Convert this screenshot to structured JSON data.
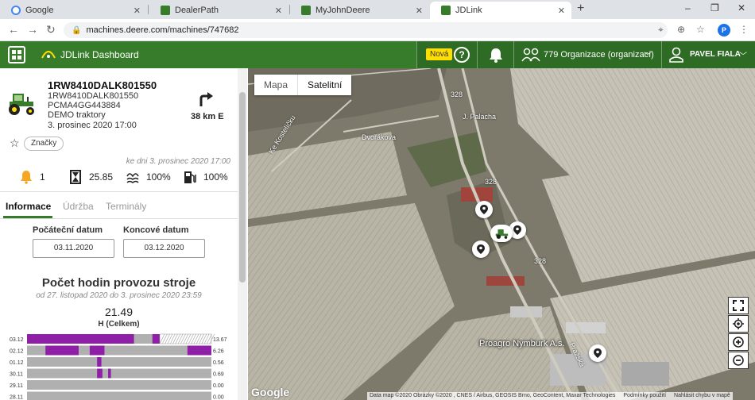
{
  "browser": {
    "tabs": [
      {
        "title": "Google",
        "favicon_color": "#4285f4"
      },
      {
        "title": "DealerPath",
        "favicon_color": "#367c2b"
      },
      {
        "title": "MyJohnDeere",
        "favicon_color": "#367c2b"
      },
      {
        "title": "JDLink",
        "favicon_color": "#367c2b"
      }
    ],
    "new_tab_icon": "+",
    "url": "machines.deere.com/machines/747682",
    "profile_initial": "P",
    "window_controls": [
      "–",
      "❐",
      "✕"
    ]
  },
  "appbar": {
    "title": "JDLink Dashboard",
    "new_badge": "Nová",
    "help_icon": "?",
    "org_label": "779 Organizace (organizací)",
    "user_name": "PAVEL FIALA",
    "brand_color": "#367c2b"
  },
  "machine": {
    "name": "1RW8410DALK801550",
    "serial": "1RW8410DALK801550",
    "terminal_id": "PCMA4GG443884",
    "group": "DEMO traktory",
    "last_seen": "3. prosinec 2020 17:00",
    "direction_distance": "38 km E",
    "tags_label": "Značky",
    "status_timestamp": "ke dni 3. prosinec 2020 17:00",
    "stats": {
      "alerts": "1",
      "engine_hours": "25.85",
      "def_level": "100%",
      "fuel_level": "100%"
    }
  },
  "tabs": [
    {
      "label": "Informace"
    },
    {
      "label": "Údržba"
    },
    {
      "label": "Terminály"
    }
  ],
  "dates": {
    "start_label": "Počáteční datum",
    "start_value": "03.11.2020",
    "end_label": "Koncové datum",
    "end_value": "03.12.2020"
  },
  "chart_data": {
    "type": "bar",
    "title": "Počet hodin provozu stroje",
    "subtitle": "od 27. listopad 2020 do 3. prosinec 2020 23:59",
    "total": "21.49",
    "unit": "H (Celkem)",
    "categories": [
      "03.12",
      "02.12",
      "01.12",
      "30.11",
      "29.11",
      "28.11"
    ],
    "values": [
      13.67,
      6.26,
      0.56,
      0.69,
      0.0,
      0.0
    ],
    "value_labels": [
      "13.67",
      "6.26",
      "0.56",
      "0.69",
      "0.00",
      "0.00"
    ],
    "active_color": "#8e1fa6",
    "idle_color": "#b0b0b0"
  },
  "map": {
    "type_map": "Mapa",
    "type_satellite": "Satelitní",
    "place_label": "Proagro Nymburk A.s.",
    "streets": [
      "J. Palacha",
      "Dvořákova",
      "Ke Kostelíčku",
      "Pražská"
    ],
    "road_numbers": [
      "328",
      "328",
      "328"
    ],
    "attribution": "Data map ©2020 Obrázky ©2020 , CNES / Airbus, GEOSIS Brno, GeoContent, Maxar Technologies",
    "terms": "Podmínky použití",
    "report": "Nahlásit chybu v mapě",
    "google": "Google"
  }
}
